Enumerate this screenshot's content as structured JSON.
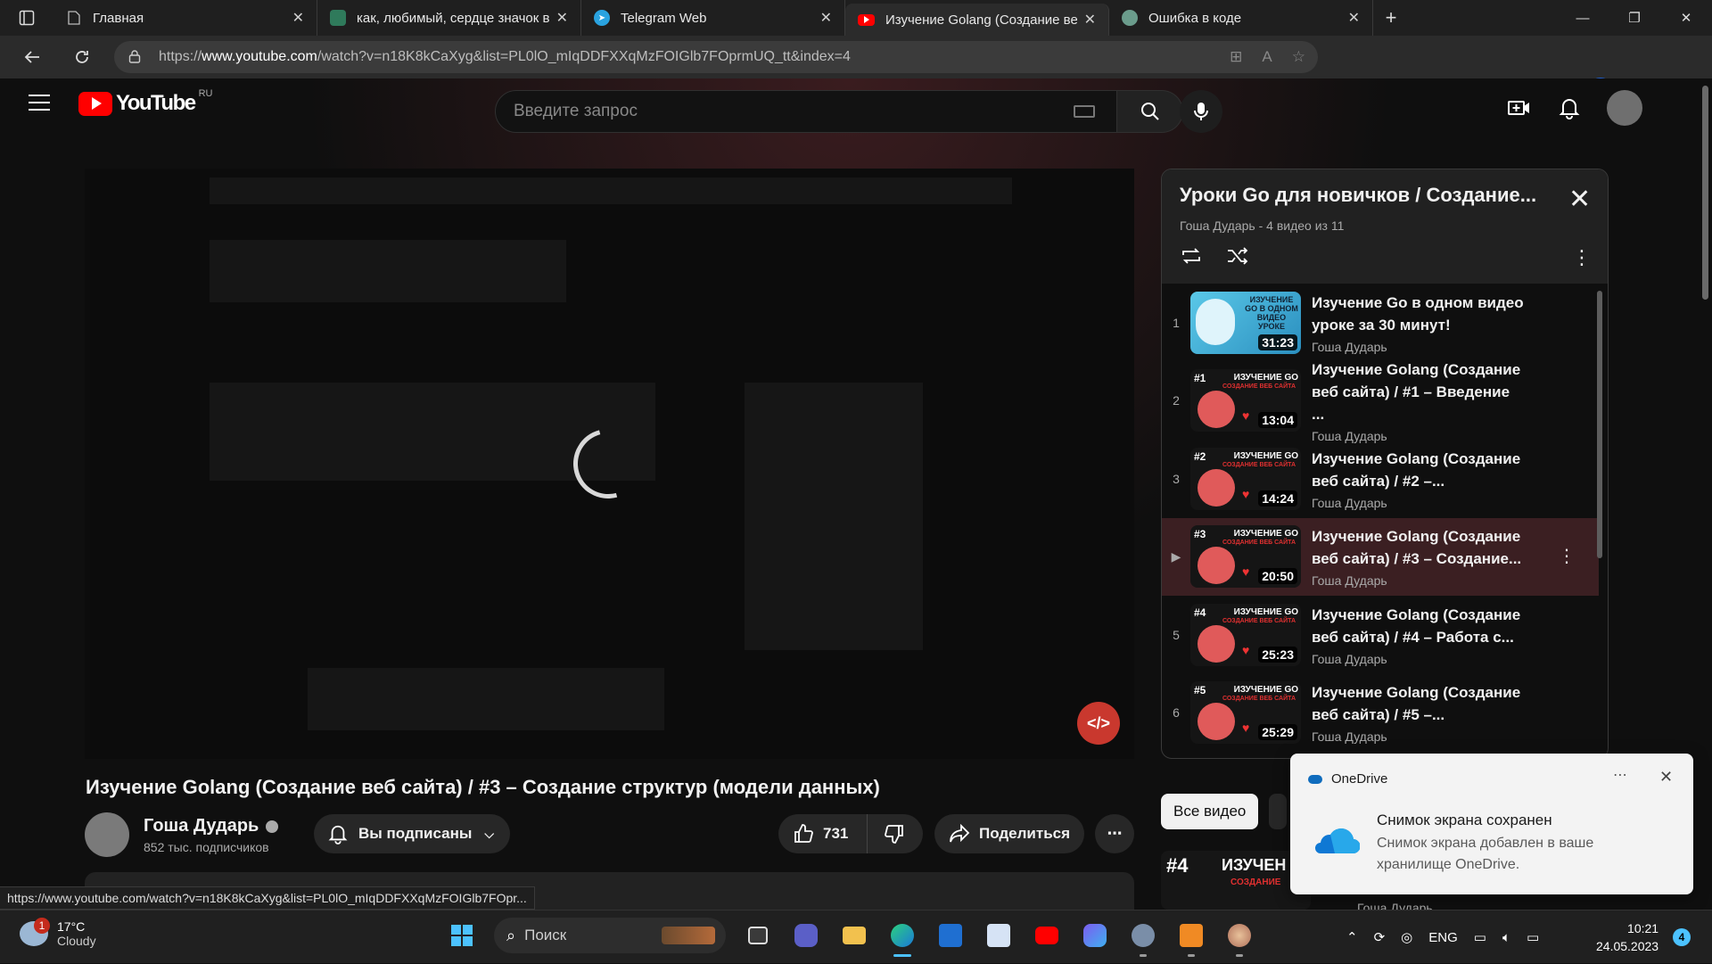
{
  "browser": {
    "tabs": [
      {
        "title": "Главная",
        "favicon": "page-icon"
      },
      {
        "title": "как, любимый, сердце значок в",
        "favicon": "image-icon"
      },
      {
        "title": "Telegram Web",
        "favicon": "telegram-icon"
      },
      {
        "title": "Изучение Golang (Создание веб",
        "favicon": "youtube-icon",
        "active": true
      },
      {
        "title": "Ошибка в коде",
        "favicon": "chatgpt-icon"
      }
    ],
    "url_prefix": "https://",
    "url_host": "www.youtube.com",
    "url_path": "/watch?v=n18K8kCaXyg&list=PL0lO_mIqDDFXXqMzFOIGlb7FOprmUQ_tt&index=4",
    "status_url": "https://www.youtube.com/watch?v=n18K8kCaXyg&list=PL0lO_mIqDDFXXqMzFOIGlb7FOpr..."
  },
  "youtube": {
    "logo_text": "YouTube",
    "country_code": "RU",
    "search_placeholder": "Введите запрос",
    "video": {
      "title": "Изучение Golang (Создание веб сайта) / #3 – Создание структур (модели данных)",
      "channel": "Гоша Дударь",
      "subscribers": "852 тыс. подписчиков",
      "subscribe_label": "Вы подписаны",
      "likes": "731",
      "share_label": "Поделиться"
    },
    "playlist": {
      "title": "Уроки Go для новичков / Создание...",
      "subtitle": "Гоша Дударь - 4 видео из 11",
      "items": [
        {
          "index": "1",
          "title": "Изучение Go в одном видео уроке за 30 минут!",
          "channel": "Гоша Дударь",
          "duration": "31:23",
          "thumb_tag": "",
          "thumb_big": "ИЗУЧЕНИЕ GO В ОДНОМ ВИДЕО УРОКЕ",
          "thumb_red": ""
        },
        {
          "index": "2",
          "title": "Изучение Golang (Создание веб сайта) / #1 – Введение ...",
          "channel": "Гоша Дударь",
          "duration": "13:04",
          "thumb_tag": "#1",
          "thumb_big": "ИЗУЧЕНИЕ GO",
          "thumb_red": "СОЗДАНИЕ ВЕБ САЙТА"
        },
        {
          "index": "3",
          "title": "Изучение Golang (Создание веб сайта) / #2 –...",
          "channel": "Гоша Дударь",
          "duration": "14:24",
          "thumb_tag": "#2",
          "thumb_big": "ИЗУЧЕНИЕ GO",
          "thumb_red": "СОЗДАНИЕ ВЕБ САЙТА"
        },
        {
          "index": "▶",
          "title": "Изучение Golang (Создание веб сайта) / #3 – Создание...",
          "channel": "Гоша Дударь",
          "duration": "20:50",
          "thumb_tag": "#3",
          "thumb_big": "ИЗУЧЕНИЕ GO",
          "thumb_red": "СОЗДАНИЕ ВЕБ САЙТА",
          "current": true
        },
        {
          "index": "5",
          "title": "Изучение Golang (Создание веб сайта) / #4 – Работа с...",
          "channel": "Гоша Дударь",
          "duration": "25:23",
          "thumb_tag": "#4",
          "thumb_big": "ИЗУЧЕНИЕ GO",
          "thumb_red": "СОЗДАНИЕ ВЕБ САЙТА"
        },
        {
          "index": "6",
          "title": "Изучение Golang (Создание веб сайта) / #5 –...",
          "channel": "Гоша Дударь",
          "duration": "25:29",
          "thumb_tag": "#5",
          "thumb_big": "ИЗУЧЕНИЕ GO",
          "thumb_red": "СОЗДАНИЕ ВЕБ САЙТА"
        }
      ]
    },
    "chips": [
      "Все видео"
    ],
    "next_rec": {
      "tag": "#4",
      "big": "ИЗУЧЕН",
      "red": "СОЗДАНИЕ",
      "channel": "Гоша Дударь"
    }
  },
  "toast": {
    "app": "OneDrive",
    "title": "Снимок экрана сохранен",
    "body": "Снимок экрана добавлен в ваше хранилище OneDrive."
  },
  "taskbar": {
    "weather_badge": "1",
    "temperature": "17°C",
    "condition": "Cloudy",
    "search_label": "Поиск",
    "language": "ENG",
    "time": "10:21",
    "date": "24.05.2023",
    "notifications": "4"
  },
  "colors": {
    "yt_red": "#ff0000",
    "current_row": "#3b1f22",
    "edge_accent": "#4cc2ff"
  }
}
